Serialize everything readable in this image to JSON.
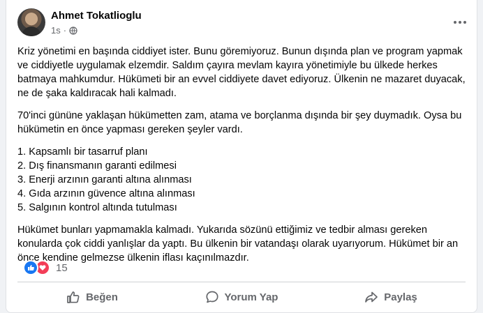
{
  "post": {
    "author": "Ahmet Tokatlioglu",
    "time": "1s",
    "visibility_icon": "globe-icon",
    "paragraphs": [
      "Kriz yönetimi en başında ciddiyet ister. Bunu göremiyoruz. Bunun dışında plan ve program yapmak ve ciddiyetle uygulamak elzemdir. Saldım çayıra mevlam kayıra yönetimiyle bu ülkede herkes batmaya mahkumdur. Hükümeti bir an evvel ciddiyete davet ediyoruz. Ülkenin ne mazaret duyacak, ne de şaka kaldıracak hali kalmadı.",
      "70'inci gününe yaklaşan hükümetten zam, atama ve borçlanma dışında bir şey duymadık. Oysa bu hükümetin en önce yapması gereken şeyler vardı."
    ],
    "list": [
      "1. Kapsamlı bir tasarruf planı",
      "2. Dış finansmanın garanti edilmesi",
      "3. Enerji arzının garanti altına alınması",
      "4. Gıda arzının güvence altına alınması",
      "5. Salgının kontrol altında tutulması"
    ],
    "closing": "Hükümet bunları yapmamakla kalmadı. Yukarıda sözünü ettiğimiz ve tedbir alması gereken konularda çok ciddi yanlışlar da yaptı. Bu ülkenin bir vatandaşı olarak uyarıyorum. Hükümet bir an önce kendine gelmezse ülkenin iflası kaçınılmazdır."
  },
  "reactions": {
    "icons": [
      "like-icon",
      "love-icon"
    ],
    "count": "15"
  },
  "actions": {
    "like_label": "Beğen",
    "comment_label": "Yorum Yap",
    "share_label": "Paylaş"
  },
  "colors": {
    "like_blue": "#1877f2",
    "love_red": "#f33e58",
    "secondary_text": "#65676b"
  }
}
